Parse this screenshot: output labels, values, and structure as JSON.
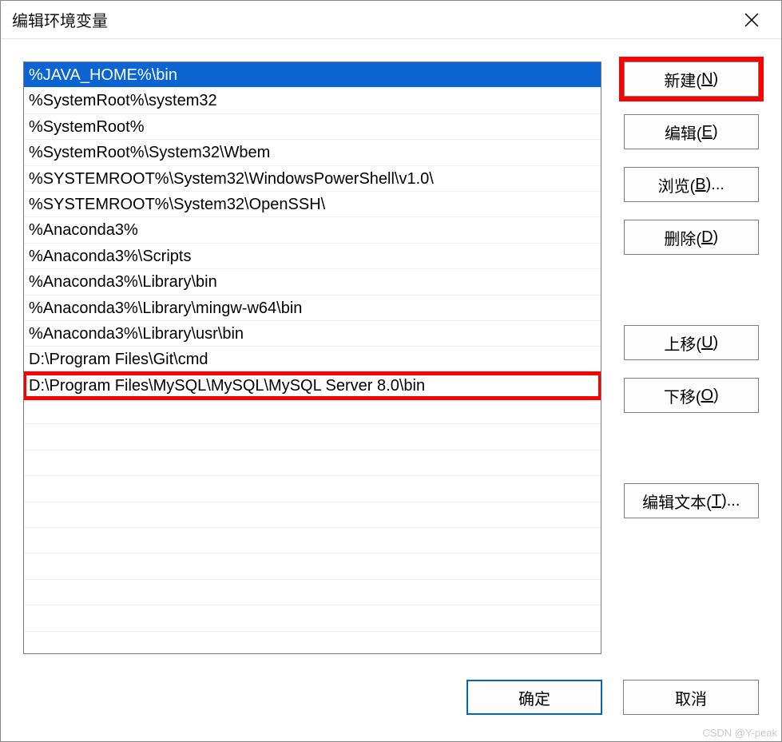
{
  "dialog": {
    "title": "编辑环境变量"
  },
  "list": {
    "items": [
      {
        "label": "%JAVA_HOME%\\bin",
        "selected": true,
        "redBox": false
      },
      {
        "label": "%SystemRoot%\\system32",
        "selected": false,
        "redBox": false
      },
      {
        "label": "%SystemRoot%",
        "selected": false,
        "redBox": false
      },
      {
        "label": "%SystemRoot%\\System32\\Wbem",
        "selected": false,
        "redBox": false
      },
      {
        "label": "%SYSTEMROOT%\\System32\\WindowsPowerShell\\v1.0\\",
        "selected": false,
        "redBox": false
      },
      {
        "label": "%SYSTEMROOT%\\System32\\OpenSSH\\",
        "selected": false,
        "redBox": false
      },
      {
        "label": "%Anaconda3%",
        "selected": false,
        "redBox": false
      },
      {
        "label": "%Anaconda3%\\Scripts",
        "selected": false,
        "redBox": false
      },
      {
        "label": "%Anaconda3%\\Library\\bin",
        "selected": false,
        "redBox": false
      },
      {
        "label": "%Anaconda3%\\Library\\mingw-w64\\bin",
        "selected": false,
        "redBox": false
      },
      {
        "label": "%Anaconda3%\\Library\\usr\\bin",
        "selected": false,
        "redBox": false
      },
      {
        "label": "D:\\Program Files\\Git\\cmd",
        "selected": false,
        "redBox": false
      },
      {
        "label": "D:\\Program Files\\MySQL\\MySQL\\MySQL Server 8.0\\bin",
        "selected": false,
        "redBox": true
      }
    ]
  },
  "buttons": {
    "new": {
      "label": "新建(",
      "key": "N",
      "suffix": ")",
      "redBox": true
    },
    "edit": {
      "label": "编辑(",
      "key": "E",
      "suffix": ")",
      "redBox": false
    },
    "browse": {
      "label": "浏览(",
      "key": "B",
      "suffix": ")...",
      "redBox": false
    },
    "delete": {
      "label": "删除(",
      "key": "D",
      "suffix": ")",
      "redBox": false
    },
    "moveUp": {
      "label": "上移(",
      "key": "U",
      "suffix": ")",
      "redBox": false
    },
    "moveDown": {
      "label": "下移(",
      "key": "O",
      "suffix": ")",
      "redBox": false
    },
    "editText": {
      "label": "编辑文本(",
      "key": "T",
      "suffix": ")...",
      "redBox": false
    }
  },
  "bottom": {
    "ok": "确定",
    "cancel": "取消"
  },
  "watermark": "CSDN @Y-peak"
}
